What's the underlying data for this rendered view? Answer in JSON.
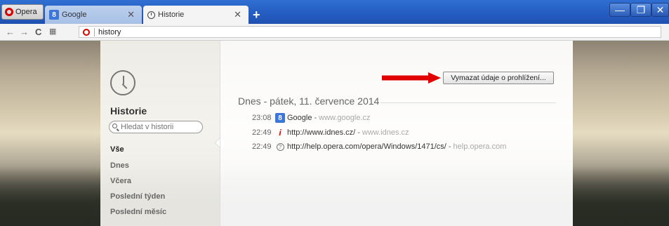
{
  "browser": {
    "menu_label": "Opera",
    "tabs": [
      {
        "label": "Google",
        "badge": "8"
      },
      {
        "label": "Historie"
      }
    ],
    "new_tab": "+",
    "window_controls": {
      "minimize": "—",
      "maximize": "❐",
      "close": "✕"
    },
    "address": "history"
  },
  "sidebar": {
    "title": "Historie",
    "search_placeholder": "Hledat v historii",
    "items": [
      {
        "label": "Vše",
        "active": true
      },
      {
        "label": "Dnes"
      },
      {
        "label": "Včera"
      },
      {
        "label": "Poslední týden"
      },
      {
        "label": "Poslední měsíc"
      }
    ]
  },
  "main": {
    "clear_button": "Vymazat údaje o prohlížení...",
    "day_header": "Dnes - pátek, 11. července 2014",
    "entries": [
      {
        "time": "23:08",
        "icon": "google-icon",
        "badge": "8",
        "title": "Google",
        "domain": "www.google.cz"
      },
      {
        "time": "22:49",
        "icon": "idnes-icon",
        "title": "http://www.idnes.cz/",
        "domain": "www.idnes.cz"
      },
      {
        "time": "22:49",
        "icon": "help-icon",
        "title": "http://help.opera.com/opera/Windows/1471/cs/",
        "domain": "help.opera.com"
      }
    ]
  },
  "colors": {
    "accent_red": "#e00000",
    "titlebar_blue": "#245cc0"
  }
}
